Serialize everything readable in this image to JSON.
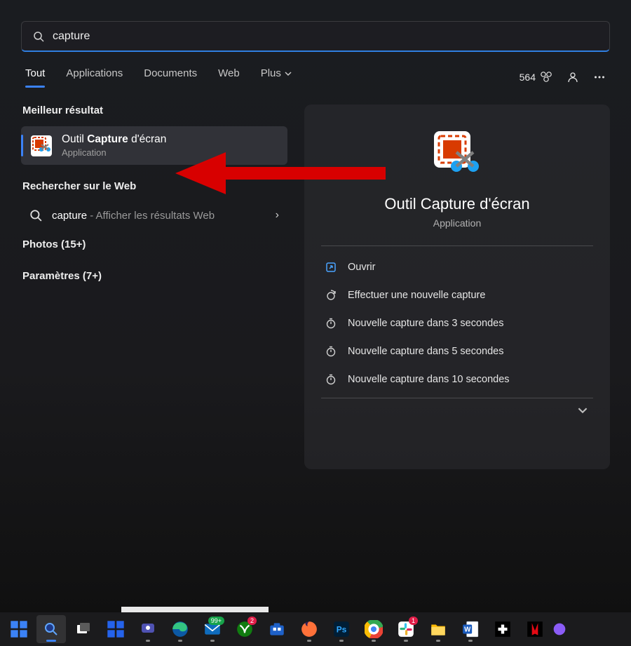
{
  "search": {
    "value": "capture"
  },
  "tabs": {
    "items": [
      "Tout",
      "Applications",
      "Documents",
      "Web",
      "Plus"
    ],
    "active_index": 0,
    "points": "564"
  },
  "best": {
    "heading": "Meilleur résultat",
    "title_prefix": "Outil ",
    "title_match": "Capture",
    "title_suffix": " d'écran",
    "subtitle": "Application"
  },
  "web": {
    "heading": "Rechercher sur le Web",
    "query": "capture",
    "suffix": " - Afficher les résultats Web"
  },
  "categories": {
    "photos": "Photos (15+)",
    "settings": "Paramètres (7+)"
  },
  "detail": {
    "title": "Outil Capture d'écran",
    "subtitle": "Application",
    "actions": [
      "Ouvrir",
      "Effectuer une nouvelle capture",
      "Nouvelle capture dans 3 secondes",
      "Nouvelle capture dans 5 secondes",
      "Nouvelle capture dans 10 secondes"
    ]
  }
}
